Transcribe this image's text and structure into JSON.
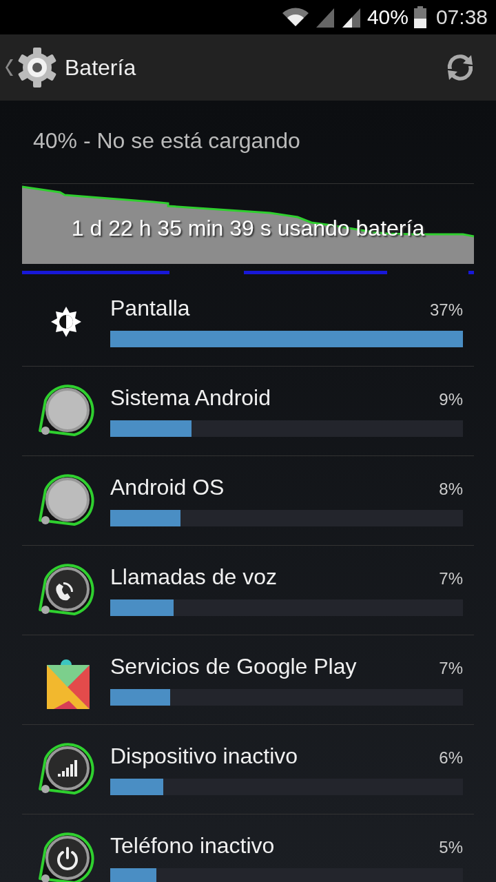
{
  "status_bar": {
    "battery": "40%",
    "time": "07:38"
  },
  "action_bar": {
    "title": "Batería"
  },
  "summary": "40% - No se está cargando",
  "usage_graph": {
    "caption": "1 d 22 h 35 min 39 s usando batería"
  },
  "items": [
    {
      "kind": "screen",
      "name": "Pantalla",
      "percent": "37%",
      "level": 1.0
    },
    {
      "kind": "system",
      "name": "Sistema Android",
      "percent": "9%",
      "level": 0.23
    },
    {
      "kind": "system",
      "name": "Android OS",
      "percent": "8%",
      "level": 0.2
    },
    {
      "kind": "call",
      "name": "Llamadas de voz",
      "percent": "7%",
      "level": 0.18
    },
    {
      "kind": "play",
      "name": "Servicios de Google Play",
      "percent": "7%",
      "level": 0.17
    },
    {
      "kind": "cell",
      "name": "Dispositivo inactivo",
      "percent": "6%",
      "level": 0.15
    },
    {
      "kind": "power",
      "name": "Teléfono inactivo",
      "percent": "5%",
      "level": 0.13
    }
  ]
}
